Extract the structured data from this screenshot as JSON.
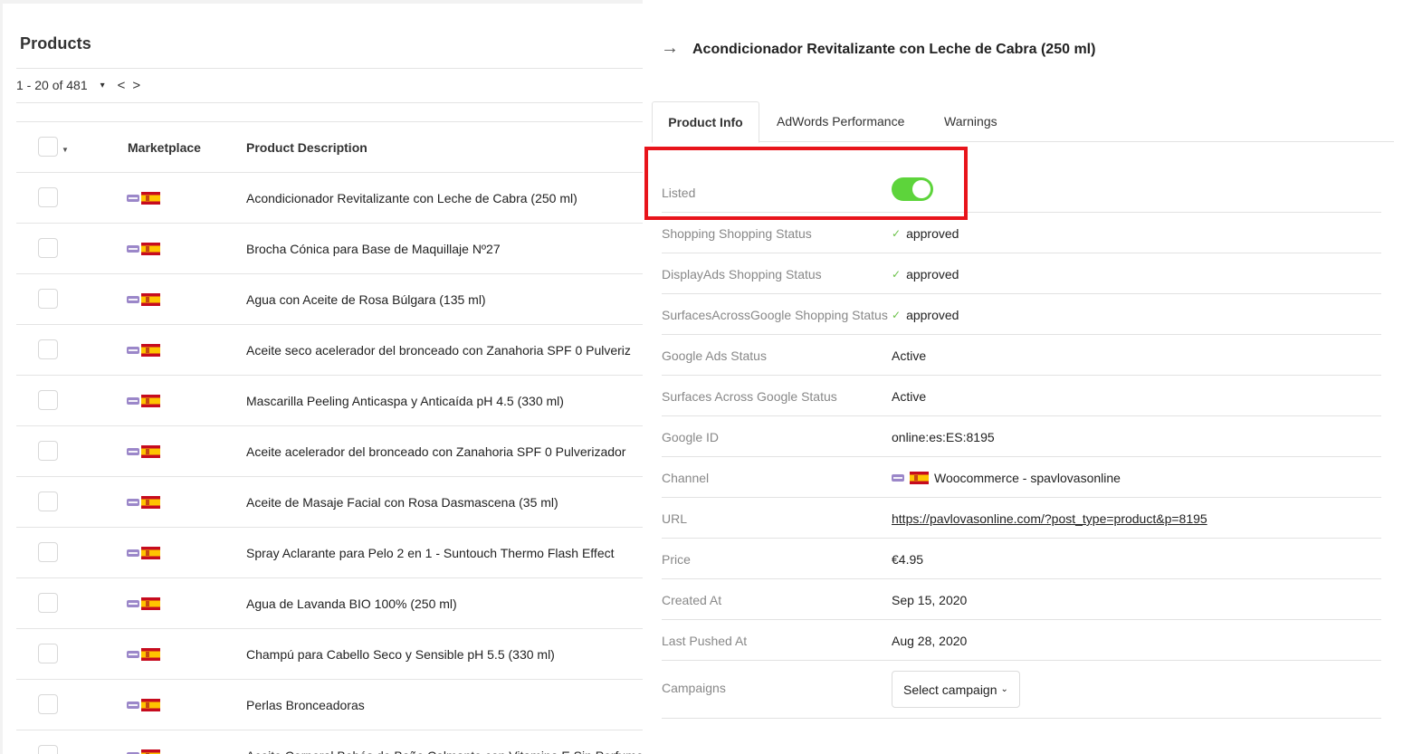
{
  "products": {
    "title": "Products",
    "pager": {
      "range": "1 - 20 of 481",
      "caret": "▾",
      "prev": "<",
      "next": ">"
    },
    "columns": {
      "marketplace": "Marketplace",
      "description": "Product Description"
    },
    "rows": [
      "Acondicionador Revitalizante con Leche de Cabra (250 ml)",
      "Brocha Cónica para Base de Maquillaje Nº27",
      "Agua con Aceite de Rosa Búlgara (135 ml)",
      "Aceite seco acelerador del bronceado con Zanahoria SPF 0 Pulveriz",
      "Mascarilla Peeling Anticaspa y Anticaída pH 4.5 (330 ml)",
      "Aceite acelerador del bronceado con Zanahoria SPF 0 Pulverizador",
      "Aceite de Masaje Facial con Rosa Dasmascena (35 ml)",
      "Spray Aclarante para Pelo 2 en 1 - Suntouch Thermo Flash Effect",
      "Agua de Lavanda BIO 100% (250 ml)",
      "Champú para Cabello Seco y Sensible pH 5.5 (330 ml)",
      "Perlas Bronceadoras",
      "Aceite Corporal Bebés de Baño Calmante con Vitamina E Sin Perfume"
    ]
  },
  "detail": {
    "arrow": "→",
    "title": "Acondicionador Revitalizante con Leche de Cabra (250 ml)",
    "tabs": [
      "Product Info",
      "AdWords Performance",
      "Warnings"
    ],
    "listed_label": "Listed",
    "listed_on": true,
    "fields": [
      {
        "label": "Shopping Shopping Status",
        "value": "approved",
        "check": "✓"
      },
      {
        "label": "DisplayAds Shopping Status",
        "value": "approved",
        "check": "✓"
      },
      {
        "label": "SurfacesAcrossGoogle Shopping Status",
        "value": "approved",
        "check": "✓"
      },
      {
        "label": "Google Ads Status",
        "value": "Active"
      },
      {
        "label": "Surfaces Across Google Status",
        "value": "Active"
      },
      {
        "label": "Google ID",
        "value": "online:es:ES:8195"
      },
      {
        "label": "Channel",
        "value": "Woocommerce - spavlovasonline"
      },
      {
        "label": "URL",
        "value": "https://pavlovasonline.com/?post_type=product&p=8195"
      },
      {
        "label": "Price",
        "value": "€4.95"
      },
      {
        "label": "Created At",
        "value": "Sep 15, 2020"
      },
      {
        "label": "Last Pushed At",
        "value": "Aug 28, 2020"
      }
    ],
    "campaigns_label": "Campaigns",
    "campaign_select": "Select campaign",
    "chevron": "⌄"
  },
  "colors": {
    "toggle_on": "#5dd43b",
    "highlight": "#e8141b",
    "check": "#6cc24a"
  },
  "icons": {
    "marketplace": [
      "woocommerce-icon",
      "spain-flag-icon"
    ]
  }
}
